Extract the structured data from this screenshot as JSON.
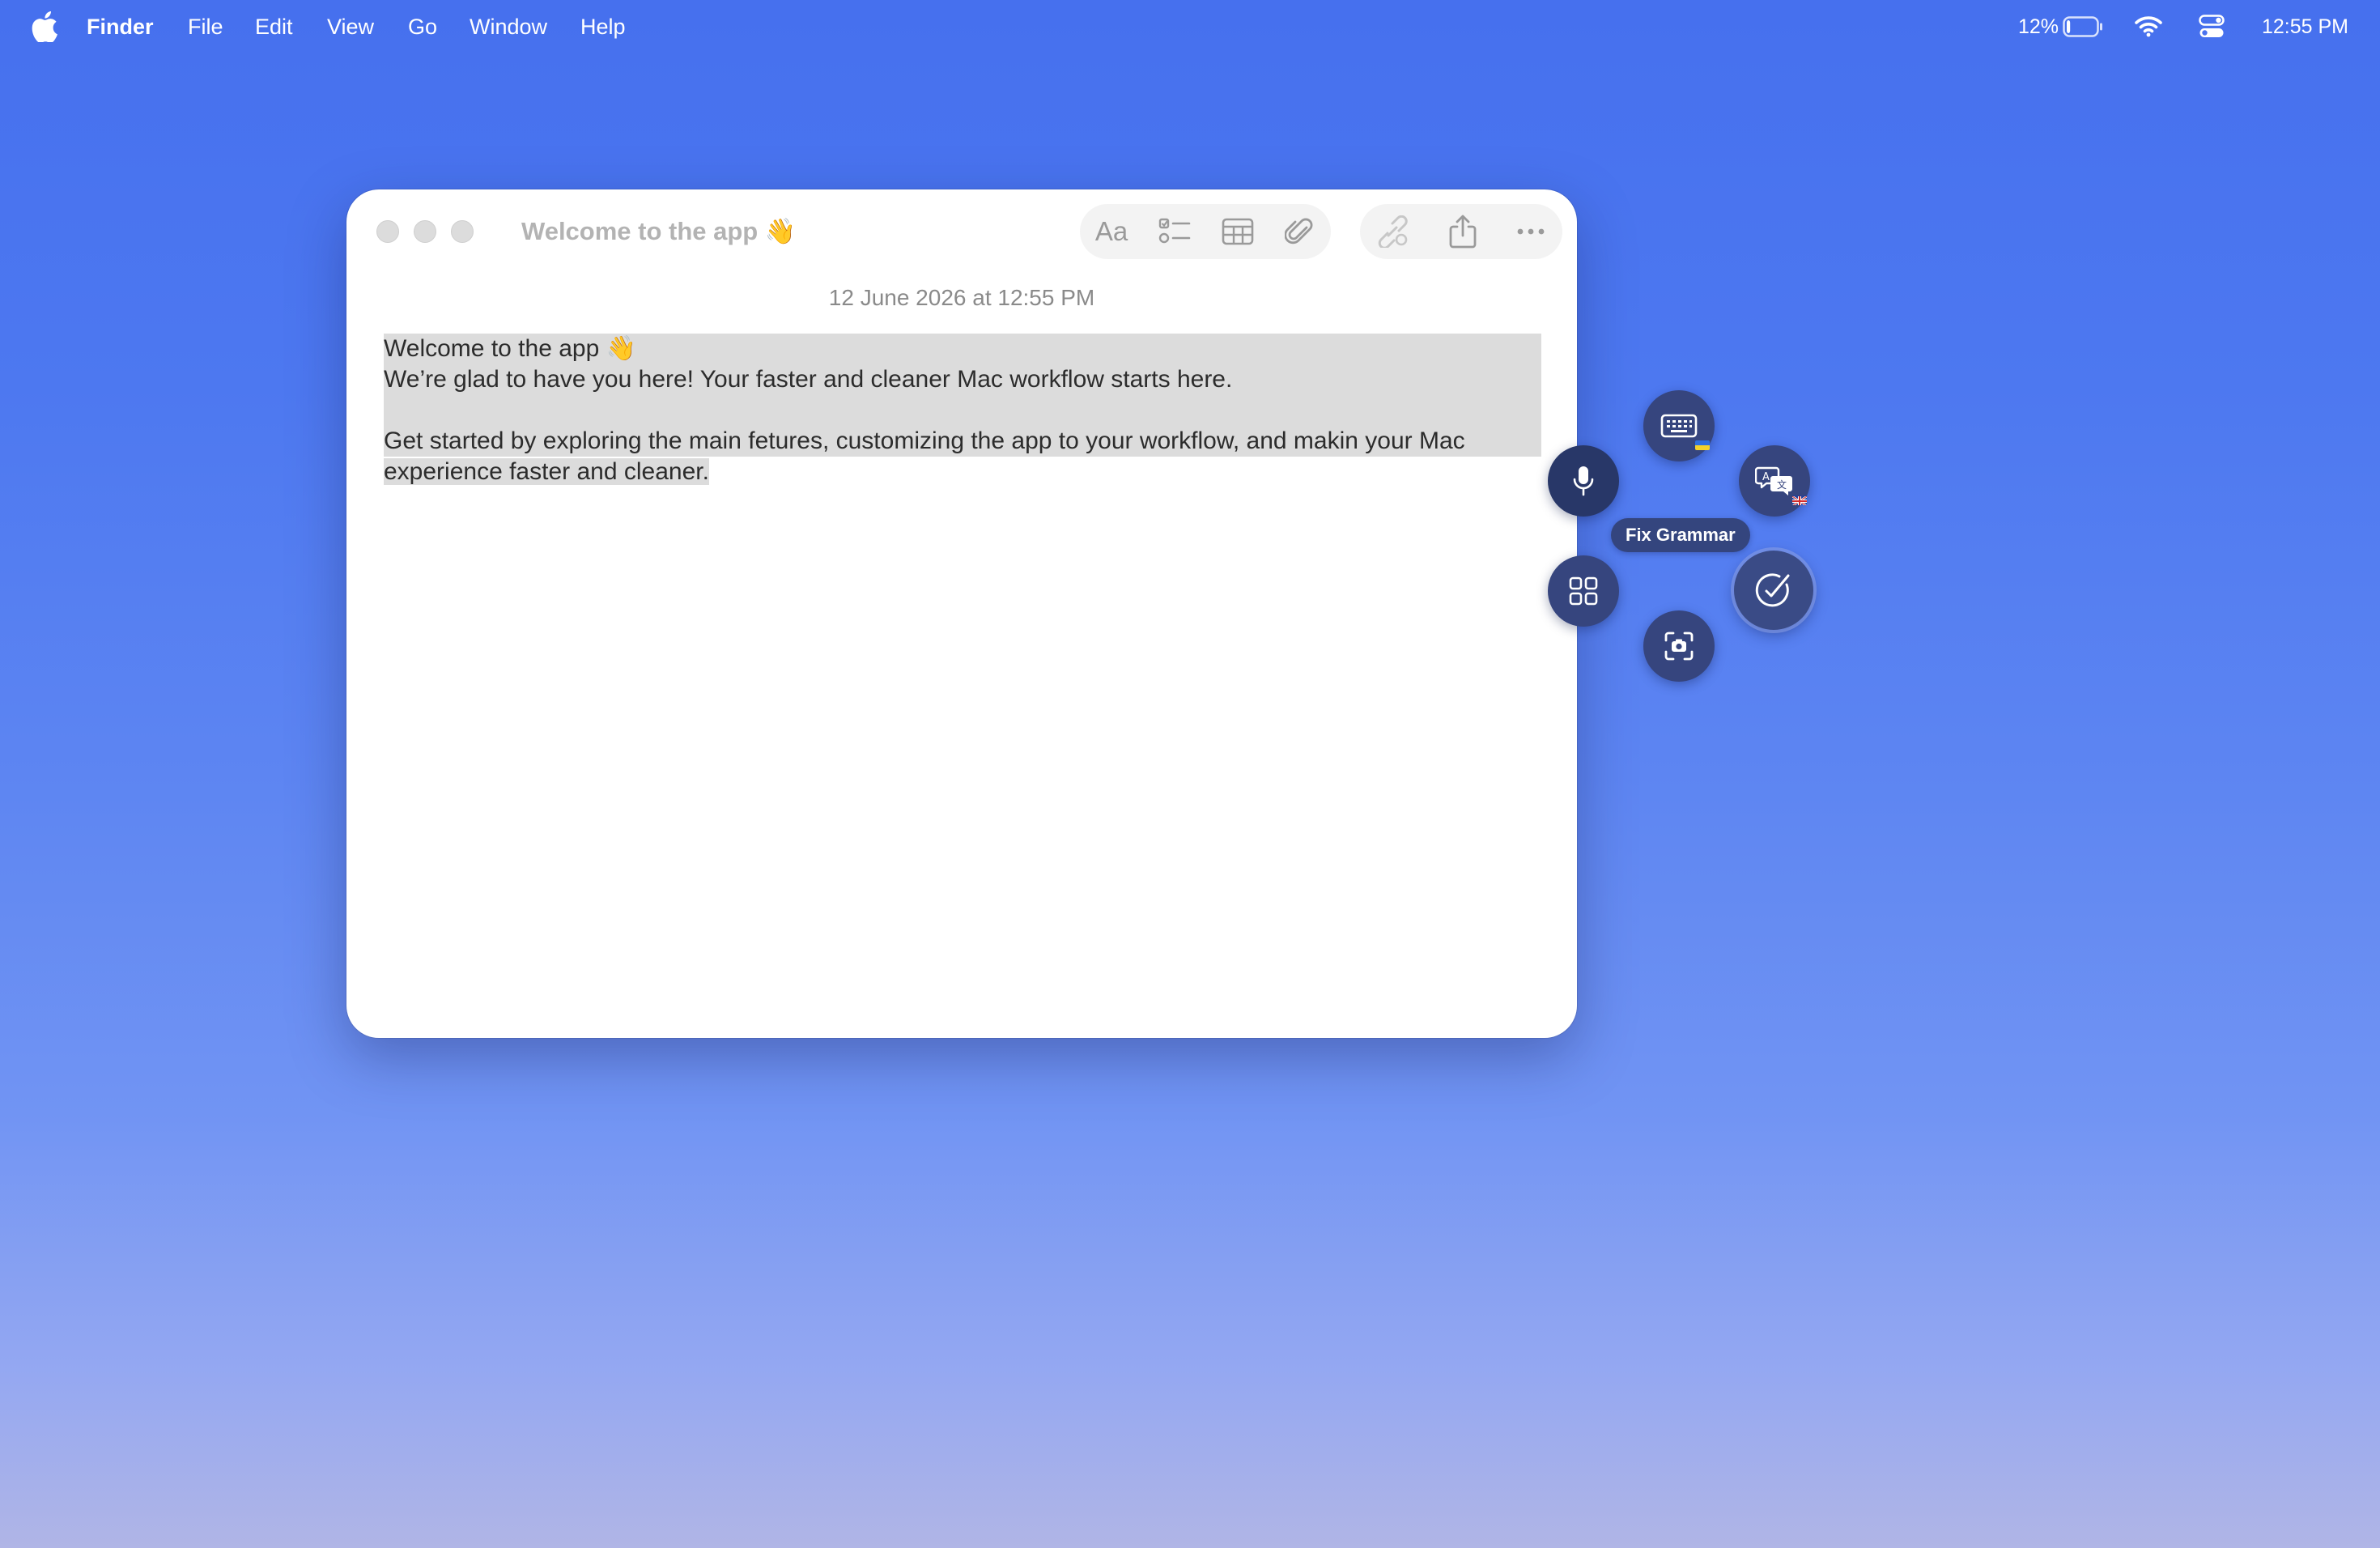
{
  "menubar": {
    "app_name": "Finder",
    "items": [
      "File",
      "Edit",
      "View",
      "Go",
      "Window",
      "Help"
    ],
    "battery_percent": "12%",
    "battery_level": 0.12,
    "clock": "12:55 PM"
  },
  "window": {
    "title": "Welcome to the app 👋",
    "toolbar": {
      "format_label": "Aa",
      "icons": [
        "checklist-icon",
        "table-icon",
        "attachment-icon",
        "collaborate-icon",
        "share-icon",
        "more-icon"
      ]
    },
    "date": "12 June 2026 at 12:55 PM",
    "note": {
      "line1": "Welcome to the app 👋",
      "line2": "We’re glad to have you here! Your faster and cleaner Mac workflow starts here.",
      "line3": "Get started by exploring the main fetures, customizing the app to your workflow, and makin your Mac",
      "line4": "experience faster and cleaner."
    }
  },
  "radial_menu": {
    "tooltip": "Fix Grammar",
    "buttons": [
      "keyboard-button",
      "dictation-button",
      "translate-button",
      "fix-grammar-button",
      "apps-grid-button",
      "screenshot-button"
    ],
    "colors": {
      "button": "#36457e",
      "active": "#3a4b86"
    }
  }
}
